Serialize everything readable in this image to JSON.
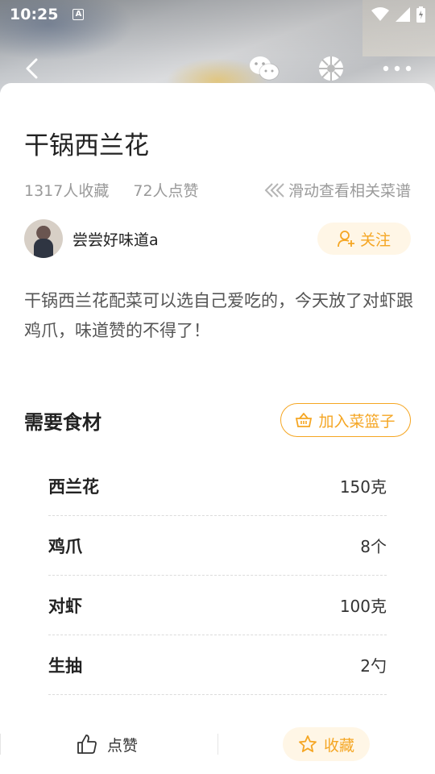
{
  "status_bar": {
    "time": "10:25",
    "notif_letter": "A"
  },
  "recipe": {
    "title": "干锅西兰花",
    "favorites": "1317人收藏",
    "likes": "72人点赞",
    "swipe_hint": "滑动查看相关菜谱",
    "description": "干锅西兰花配菜可以选自己爱吃的，今天放了对虾跟鸡爪，味道赞的不得了！"
  },
  "author": {
    "name": "尝尝好味道a",
    "follow_label": "关注"
  },
  "ingredients_section": {
    "title": "需要食材",
    "basket_label": "加入菜篮子",
    "items": [
      {
        "name": "西兰花",
        "qty": "150克"
      },
      {
        "name": "鸡爪",
        "qty": "8个"
      },
      {
        "name": "对虾",
        "qty": "100克"
      },
      {
        "name": "生抽",
        "qty": "2勺"
      }
    ]
  },
  "bottom_bar": {
    "like_label": "点赞",
    "fav_label": "收藏"
  },
  "icons": {
    "back": "back-arrow-icon",
    "wechat": "wechat-icon",
    "moments": "wechat-moments-icon",
    "more": "more-dots-icon",
    "wifi": "wifi-icon",
    "signal": "signal-icon",
    "battery": "battery-icon",
    "follow": "add-user-icon",
    "basket": "basket-icon",
    "swipe": "double-chevron-left-icon",
    "like": "thumbs-up-icon",
    "fav": "star-icon"
  },
  "colors": {
    "accent": "#f5a623",
    "accent_bg": "#fff6e6",
    "text_muted": "#9a9a9a"
  }
}
